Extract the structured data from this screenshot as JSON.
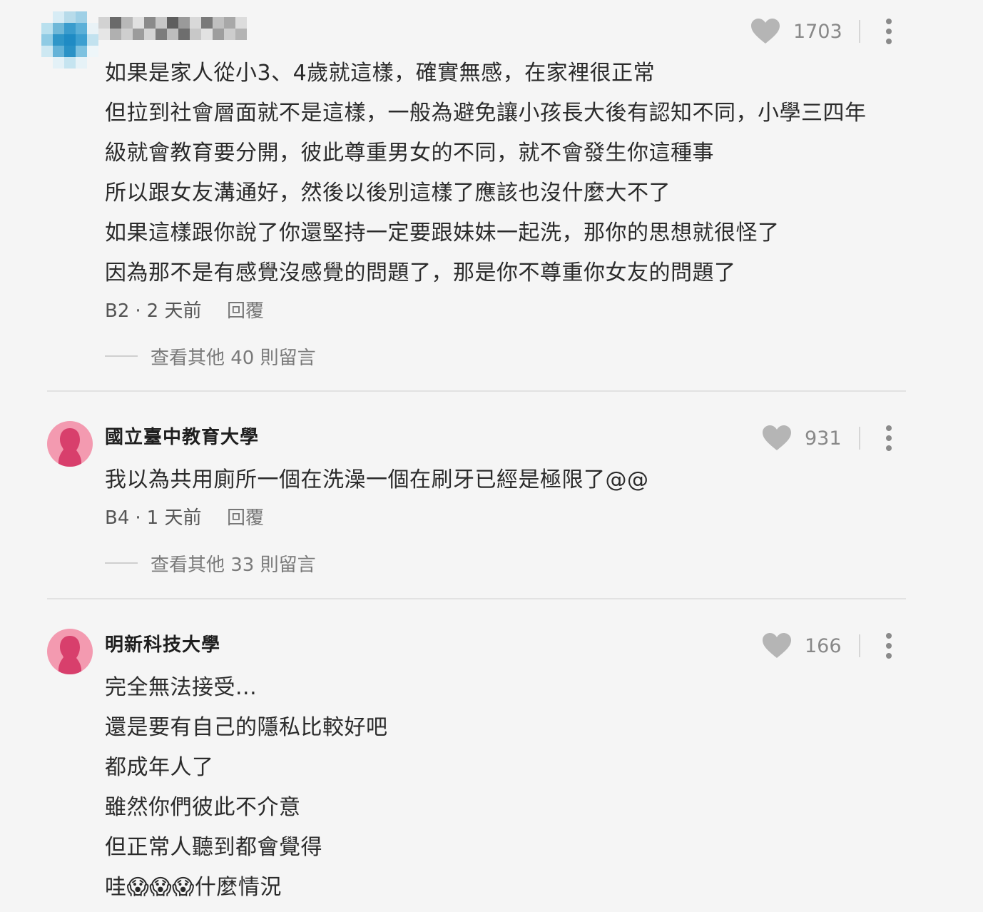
{
  "comments": [
    {
      "author": "",
      "likes": "1703",
      "lines": [
        "如果是家人從小3、4歲就這樣，確實無感，在家裡很正常",
        "但拉到社會層面就不是這樣，一般為避免讓小孩長大後有認知不同，小學三四年",
        "級就會教育要分開，彼此尊重男女的不同，就不會發生你這種事",
        "所以跟女友溝通好，然後以後別這樣了應該也沒什麼大不了",
        "如果這樣跟你說了你還堅持一定要跟妹妹一起洗，那你的思想就很怪了",
        "因為那不是有感覺沒感覺的問題了，那是你不尊重你女友的問題了"
      ],
      "floor": "B2",
      "time": "2 天前",
      "reply_label": "回覆",
      "more_replies": "查看其他 40 則留言"
    },
    {
      "author": "國立臺中教育大學",
      "likes": "931",
      "lines": [
        "我以為共用廁所一個在洗澡一個在刷牙已經是極限了@@"
      ],
      "floor": "B4",
      "time": "1 天前",
      "reply_label": "回覆",
      "more_replies": "查看其他 33 則留言"
    },
    {
      "author": "明新科技大學",
      "likes": "166",
      "lines": [
        "完全無法接受...",
        "還是要有自己的隱私比較好吧",
        "都成年人了",
        "雖然你們彼此不介意",
        "但正常人聽到都會覺得",
        "哇😱😱😱什麼情況"
      ]
    }
  ],
  "icons": {
    "like": "heart-icon",
    "options": "more-vertical-icon",
    "avatar": "female-silhouette-icon"
  },
  "colors": {
    "background": "#f5f5f5",
    "avatar_pink": "#f39ab0",
    "silhouette": "#d83f6c",
    "heart_gray": "#b5b5b5"
  }
}
